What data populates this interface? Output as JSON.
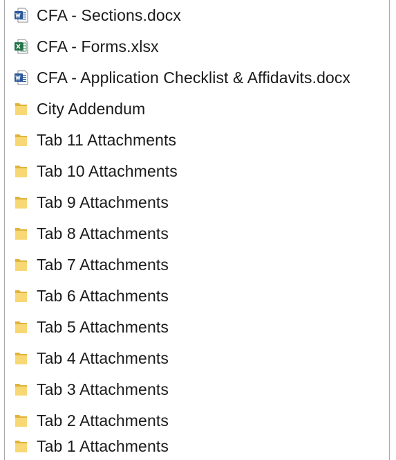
{
  "files": [
    {
      "label": "CFA - Sections.docx",
      "icon": "word-document-icon"
    },
    {
      "label": "CFA - Forms.xlsx",
      "icon": "excel-spreadsheet-icon"
    },
    {
      "label": "CFA - Application Checklist & Affidavits.docx",
      "icon": "word-document-icon"
    },
    {
      "label": "City Addendum",
      "icon": "folder-icon"
    },
    {
      "label": "Tab 11 Attachments",
      "icon": "folder-icon"
    },
    {
      "label": "Tab 10 Attachments",
      "icon": "folder-icon"
    },
    {
      "label": "Tab 9 Attachments",
      "icon": "folder-icon"
    },
    {
      "label": "Tab 8 Attachments",
      "icon": "folder-icon"
    },
    {
      "label": "Tab 7 Attachments",
      "icon": "folder-icon"
    },
    {
      "label": "Tab 6 Attachments",
      "icon": "folder-icon"
    },
    {
      "label": "Tab 5 Attachments",
      "icon": "folder-icon"
    },
    {
      "label": "Tab 4 Attachments",
      "icon": "folder-icon"
    },
    {
      "label": "Tab 3 Attachments",
      "icon": "folder-icon"
    },
    {
      "label": "Tab 2 Attachments",
      "icon": "folder-icon"
    },
    {
      "label": "Tab 1 Attachments",
      "icon": "folder-icon"
    }
  ],
  "colors": {
    "word_blue": "#2b579a",
    "excel_green": "#217346",
    "folder_yellow": "#f8d775",
    "folder_dark": "#e0b43c"
  }
}
